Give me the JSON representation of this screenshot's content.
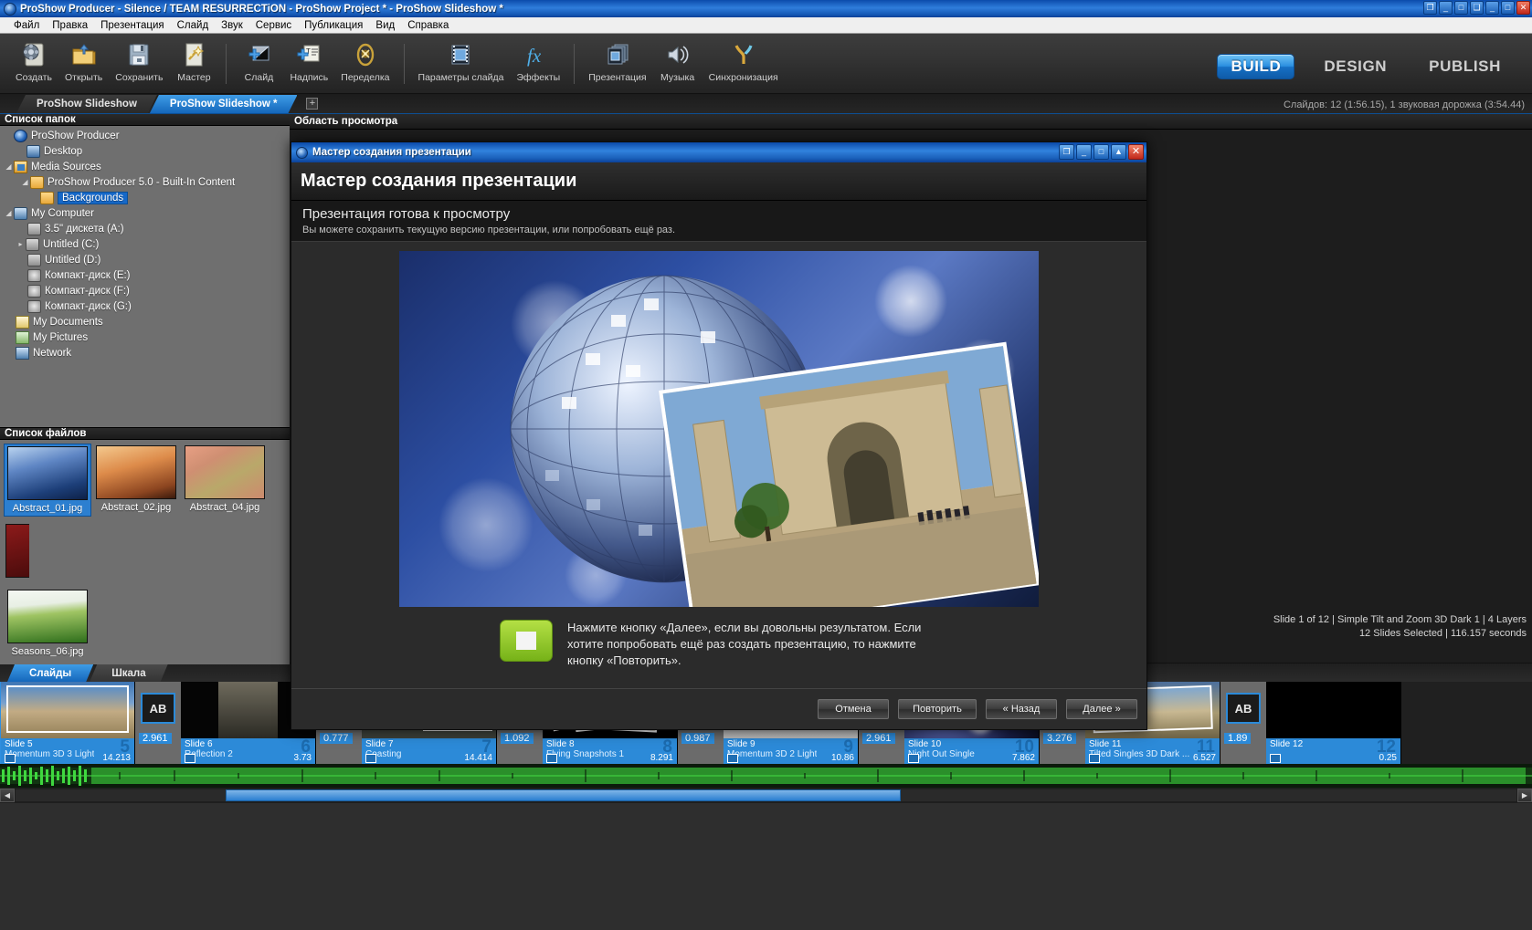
{
  "window": {
    "title": "ProShow Producer - Silence / TEAM RESURRECTiON - ProShow Project * - ProShow Slideshow *",
    "icon": "proshow-logo-icon",
    "buttons": [
      {
        "name": "restore-down-button",
        "glyph": "❐"
      },
      {
        "name": "minimize-button",
        "glyph": "_"
      },
      {
        "name": "maximize-button",
        "glyph": "□"
      },
      {
        "name": "restore-button",
        "glyph": "❑"
      },
      {
        "name": "minimize2-button",
        "glyph": "_"
      },
      {
        "name": "maximize2-button",
        "glyph": "□"
      },
      {
        "name": "close-button",
        "glyph": "✕"
      }
    ]
  },
  "menubar": {
    "items": [
      {
        "label": "Файл"
      },
      {
        "label": "Правка"
      },
      {
        "label": "Презентация"
      },
      {
        "label": "Слайд"
      },
      {
        "label": "Звук"
      },
      {
        "label": "Сервис"
      },
      {
        "label": "Публикация"
      },
      {
        "label": "Вид"
      },
      {
        "label": "Справка"
      }
    ]
  },
  "toolbar": {
    "group1": [
      {
        "label": "Создать",
        "icon": "new-project-icon"
      },
      {
        "label": "Открыть",
        "icon": "open-folder-icon"
      },
      {
        "label": "Сохранить",
        "icon": "save-floppy-icon"
      },
      {
        "label": "Мастер",
        "icon": "wizard-wand-icon"
      }
    ],
    "group2": [
      {
        "label": "Слайд",
        "icon": "add-slide-icon"
      },
      {
        "label": "Надпись",
        "icon": "add-caption-icon"
      },
      {
        "label": "Переделка",
        "icon": "remix-icon"
      }
    ],
    "group3": [
      {
        "label": "Параметры слайда",
        "icon": "slide-options-icon"
      },
      {
        "label": "Эффекты",
        "icon": "effects-fx-icon"
      }
    ],
    "group4": [
      {
        "label": "Презентация",
        "icon": "show-options-icon"
      },
      {
        "label": "Музыка",
        "icon": "music-speaker-icon"
      },
      {
        "label": "Синхронизация",
        "icon": "sync-branch-icon"
      }
    ],
    "modes": [
      {
        "label": "BUILD",
        "active": true
      },
      {
        "label": "DESIGN",
        "active": false
      },
      {
        "label": "PUBLISH",
        "active": false
      }
    ]
  },
  "tabstrip": {
    "tabs": [
      {
        "label": "ProShow Slideshow",
        "active": false
      },
      {
        "label": "ProShow Slideshow *",
        "active": true
      }
    ],
    "add_label": "+",
    "status": "Слайдов: 12 (1:56.15), 1 звуковая дорожка (3:54.44)"
  },
  "folder_panel": {
    "header": "Список папок",
    "items": [
      {
        "label": "ProShow Producer",
        "icon": "proshow-logo-icon",
        "indent": 0,
        "expander": "",
        "selected": false
      },
      {
        "label": "Desktop",
        "icon": "desktop-icon",
        "indent": 1,
        "expander": "",
        "selected": false
      },
      {
        "label": "Media Sources",
        "icon": "media-folder-icon",
        "indent": 1,
        "expander": "◢",
        "selected": false
      },
      {
        "label": "ProShow Producer 5.0 - Built-In Content",
        "icon": "folder-icon",
        "indent": 2,
        "expander": "◢",
        "selected": false
      },
      {
        "label": "Backgrounds",
        "icon": "folder-icon",
        "indent": 3,
        "expander": "",
        "selected": true
      },
      {
        "label": "My Computer",
        "icon": "computer-icon",
        "indent": 1,
        "expander": "◢",
        "selected": false
      },
      {
        "label": "3.5\" дискета (A:)",
        "icon": "floppy-drive-icon",
        "indent": 2,
        "expander": "",
        "selected": false
      },
      {
        "label": "Untitled (C:)",
        "icon": "hard-drive-icon",
        "indent": 2,
        "expander": "▸",
        "selected": false
      },
      {
        "label": "Untitled (D:)",
        "icon": "hard-drive-icon",
        "indent": 2,
        "expander": "",
        "selected": false
      },
      {
        "label": "Компакт-диск (E:)",
        "icon": "cd-drive-icon",
        "indent": 2,
        "expander": "",
        "selected": false
      },
      {
        "label": "Компакт-диск (F:)",
        "icon": "cd-drive-icon",
        "indent": 2,
        "expander": "",
        "selected": false
      },
      {
        "label": "Компакт-диск (G:)",
        "icon": "cd-drive-icon",
        "indent": 2,
        "expander": "",
        "selected": false
      },
      {
        "label": "My Documents",
        "icon": "documents-icon",
        "indent": 1,
        "expander": "",
        "selected": false
      },
      {
        "label": "My Pictures",
        "icon": "pictures-icon",
        "indent": 1,
        "expander": "",
        "selected": false
      },
      {
        "label": "Network",
        "icon": "network-icon",
        "indent": 1,
        "expander": "",
        "selected": false
      }
    ]
  },
  "file_panel": {
    "header": "Список файлов",
    "files": [
      {
        "name": "Abstract_01.jpg",
        "selected": true,
        "thumb": "abstract-blue"
      },
      {
        "name": "Abstract_02.jpg",
        "selected": false,
        "thumb": "abstract-orange"
      },
      {
        "name": "Abstract_04.jpg",
        "selected": false,
        "thumb": "abstract-red"
      },
      {
        "name": "",
        "selected": false,
        "thumb": "abstract-dark-red"
      },
      {
        "name": "Seasons_06.jpg",
        "selected": false,
        "thumb": "seasons-green"
      }
    ]
  },
  "preview_panel": {
    "header": "Область просмотра",
    "status_line1": "Slide 1 of 12  |  Simple Tilt and Zoom 3D Dark 1  |  4 Layers",
    "status_line2": "12 Slides Selected  |  116.157 seconds"
  },
  "timeline": {
    "tabs": [
      {
        "label": "Слайды",
        "active": true
      },
      {
        "label": "Шкала",
        "active": false
      }
    ],
    "slides": [
      {
        "title": "Slide 5",
        "subtitle": "Momentum 3D 3 Light",
        "number": "5",
        "duration": "14.213",
        "thumb": "registan-day"
      },
      {
        "title": "Slide 6",
        "subtitle": "Reflection 2",
        "number": "6",
        "duration": "3.73",
        "thumb": "arch-dark"
      },
      {
        "title": "Slide 7",
        "subtitle": "Coasting",
        "number": "7",
        "duration": "14.414",
        "thumb": "arch-frame"
      },
      {
        "title": "Slide 8",
        "subtitle": "Flying Snapshots 1",
        "number": "8",
        "duration": "8.291",
        "thumb": "snapshots"
      },
      {
        "title": "Slide 9",
        "subtitle": "Momentum 3D 2 Light",
        "number": "9",
        "duration": "10.86",
        "thumb": "blur-light"
      },
      {
        "title": "Slide 10",
        "subtitle": "Night Out Single",
        "number": "10",
        "duration": "7.862",
        "thumb": "bokeh-night"
      },
      {
        "title": "Slide 11",
        "subtitle": "Tilted Singles 3D Dark ...",
        "number": "11",
        "duration": "6.527",
        "thumb": "registan-tilt"
      },
      {
        "title": "Slide 12",
        "subtitle": "",
        "number": "12",
        "duration": "0.25",
        "thumb": "black"
      }
    ],
    "transitions": [
      {
        "duration": "2.961",
        "icon": "ab-crossfade-icon",
        "glyph": "AB"
      },
      {
        "duration": "0.777",
        "icon": "red-wipe-icon",
        "glyph": "▼"
      },
      {
        "duration": "1.092",
        "icon": "bars-wipe-icon",
        "glyph": "≡"
      },
      {
        "duration": "0.987",
        "icon": "four-arrows-icon",
        "glyph": "↔"
      },
      {
        "duration": "2.961",
        "icon": "blinds-icon",
        "glyph": "|||"
      },
      {
        "duration": "3.276",
        "icon": "blinds2-icon",
        "glyph": "|||"
      },
      {
        "duration": "1.89",
        "icon": "ab-crossfade-icon",
        "glyph": "AB"
      }
    ]
  },
  "dialog": {
    "titlebar": "Мастер создания презентации",
    "heading": "Мастер создания презентации",
    "step_title": "Презентация готова к просмотру",
    "step_sub": "Вы можете сохранить текущую версию презентации, или попробовать ещё раз.",
    "note": "Нажмите кнопку «Далее», если вы довольны результатом. Если хотите попробовать ещё раз создать презентацию, то нажмите кнопку «Повторить».",
    "buttons": [
      {
        "label": "Отмена",
        "name": "cancel-button"
      },
      {
        "label": "Повторить",
        "name": "retry-button"
      },
      {
        "label": "« Назад",
        "name": "back-button"
      },
      {
        "label": "Далее »",
        "name": "next-button"
      }
    ],
    "titlebar_buttons": [
      {
        "name": "help-button",
        "glyph": "❐"
      },
      {
        "name": "minimize-button",
        "glyph": "_"
      },
      {
        "name": "maximize-button",
        "glyph": "□"
      },
      {
        "name": "rollup-button",
        "glyph": "▲"
      },
      {
        "name": "close-button",
        "glyph": "✕"
      }
    ]
  },
  "colors": {
    "accent": "#2c8ad8",
    "active_tab": "#1567bb",
    "selection": "#1668c8",
    "note_chip": "#8dc523",
    "close_red": "#c1281a"
  }
}
